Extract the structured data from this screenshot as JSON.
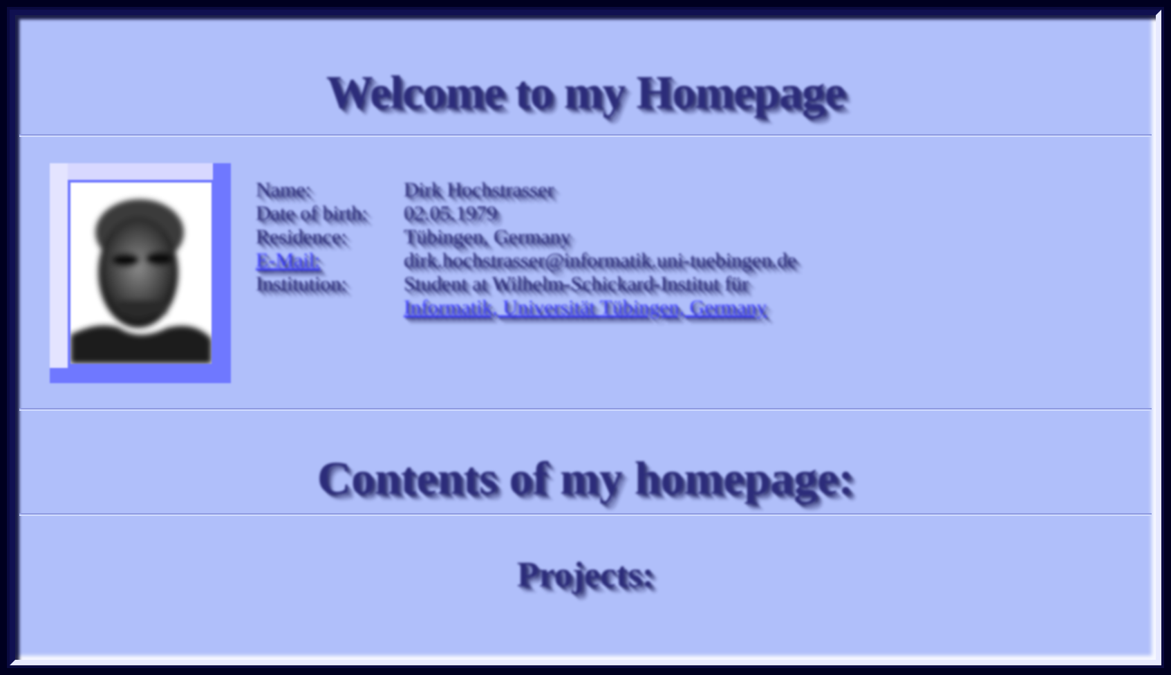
{
  "header": {
    "title": "Welcome to my Homepage"
  },
  "profile": {
    "photo_alt": "portrait photo",
    "rows": [
      {
        "label": "Name:",
        "value": "Dirk Hochstrasser"
      },
      {
        "label": "Date of birth:",
        "value": "02.05.1979"
      },
      {
        "label": "Residence:",
        "value": "Tübingen, Germany"
      },
      {
        "label": "E-Mail:",
        "value": "dirk.hochstrasser@informatik.uni-tuebingen.de"
      },
      {
        "label": "Institution:",
        "value": "Student at Wilhelm-Schickard-Institut für"
      },
      {
        "label": "",
        "value": "Informatik, Universität Tübingen, Germany"
      }
    ]
  },
  "contents": {
    "title": "Contents of my homepage:"
  },
  "projects": {
    "heading": "Projects:"
  },
  "colors": {
    "background": "#b0bffa",
    "text": "#2c2c7a",
    "link": "#3a3aff",
    "photo_frame": "#6f78ff"
  }
}
